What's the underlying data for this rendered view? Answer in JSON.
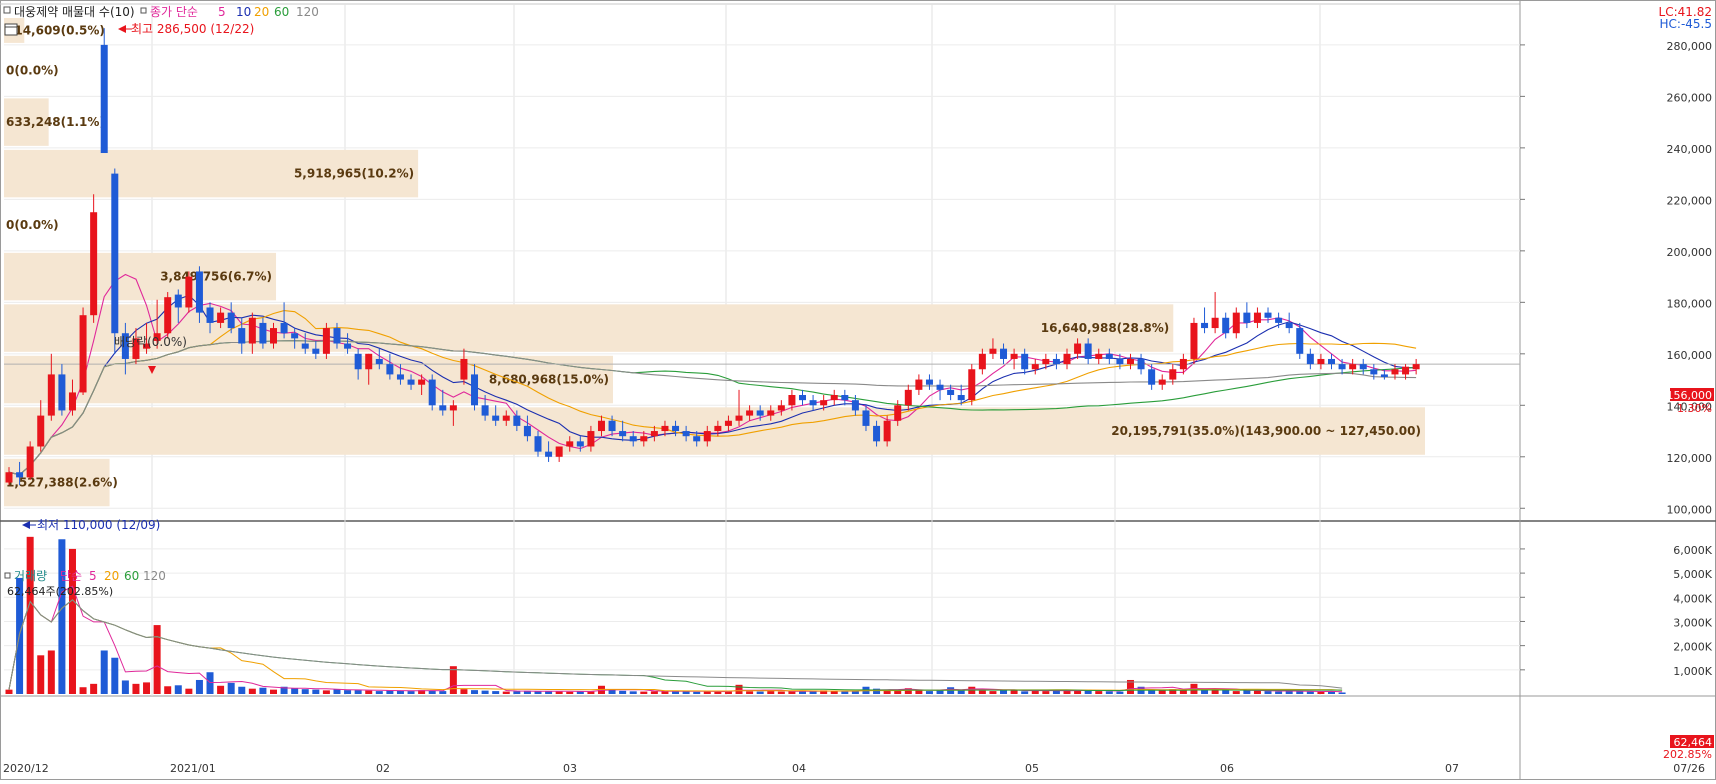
{
  "header": {
    "icon": "square-icon",
    "title": "대웅제약 매물대 수(10)",
    "ma_label": "종가 단순",
    "ma_periods": [
      "5",
      "10",
      "20",
      "60",
      "120"
    ],
    "lc_label": "LC:41.82",
    "hc_label": "HC:-45.5"
  },
  "volume_header": {
    "title": "거래량",
    "ma_label": "단순",
    "ma_periods": [
      "5",
      "20",
      "60",
      "120"
    ],
    "current": "62,464주(202.85%)"
  },
  "annotations": {
    "high": "최고 286,500 (12/22)",
    "low": "최저 110,000 (12/09)",
    "ex_rights": "배당락(0.0%)"
  },
  "badges": {
    "price": "156,000",
    "change": "1.30%",
    "volume": "62,464",
    "volume_pct": "202.85%"
  },
  "colors": {
    "up": "#e8141c",
    "down": "#1f5bd6",
    "ma5": "#e0289a",
    "ma10": "#1b2fb0",
    "ma20": "#f0a000",
    "ma60": "#2a9d3a",
    "ma120": "#8a8a8a",
    "profile": "#f5e6d2",
    "profile_text": "#5a3a10"
  },
  "chart_data": [
    {
      "type": "candlestick",
      "title": "대웅제약 매물대 수(10)",
      "ylim": [
        97000,
        292000
      ],
      "y_ticks": [
        "100,000",
        "120,000",
        "140,000",
        "160,000",
        "180,000",
        "200,000",
        "220,000",
        "240,000",
        "260,000",
        "280,000"
      ],
      "x_labels": [
        "2020/12",
        "2021/01",
        "02",
        "03",
        "04",
        "05",
        "06",
        "07",
        "07/26"
      ],
      "ohlc": [
        [
          110000,
          116000,
          109000,
          114000
        ],
        [
          114000,
          118000,
          109000,
          112000
        ],
        [
          112000,
          126000,
          111000,
          124000
        ],
        [
          124000,
          142000,
          122000,
          136000
        ],
        [
          136000,
          160000,
          134000,
          152000
        ],
        [
          152000,
          156000,
          136000,
          138000
        ],
        [
          138000,
          150000,
          136000,
          145000
        ],
        [
          145000,
          178000,
          144000,
          175000
        ],
        [
          175000,
          222000,
          172000,
          215000
        ],
        [
          280000,
          286500,
          238000,
          238000
        ],
        [
          230000,
          232000,
          160000,
          168000
        ],
        [
          168000,
          172000,
          152000,
          158000
        ],
        [
          158000,
          170000,
          156000,
          166000
        ],
        [
          162000,
          172000,
          160000,
          164000
        ],
        [
          165000,
          181000,
          162000,
          168000
        ],
        [
          168000,
          184000,
          166000,
          182000
        ],
        [
          183000,
          185000,
          172000,
          178000
        ],
        [
          178000,
          192000,
          176000,
          190000
        ],
        [
          192000,
          194000,
          172000,
          176000
        ],
        [
          178000,
          180000,
          168000,
          172000
        ],
        [
          172000,
          178000,
          170000,
          176000
        ],
        [
          176000,
          180000,
          168000,
          170000
        ],
        [
          170000,
          174000,
          160000,
          164000
        ],
        [
          164000,
          176000,
          160000,
          174000
        ],
        [
          172000,
          174000,
          162000,
          164000
        ],
        [
          164000,
          172000,
          162000,
          170000
        ],
        [
          172000,
          180000,
          166000,
          168000
        ],
        [
          168000,
          170000,
          162000,
          166000
        ],
        [
          164000,
          168000,
          160000,
          162000
        ],
        [
          162000,
          165000,
          158000,
          160000
        ],
        [
          160000,
          172000,
          158000,
          170000
        ],
        [
          170000,
          172000,
          162000,
          164000
        ],
        [
          164000,
          168000,
          160000,
          162000
        ],
        [
          160000,
          162000,
          150000,
          154000
        ],
        [
          154000,
          160000,
          148000,
          160000
        ],
        [
          158000,
          162000,
          154000,
          156000
        ],
        [
          156000,
          160000,
          150000,
          152000
        ],
        [
          152000,
          156000,
          148000,
          150000
        ],
        [
          150000,
          152000,
          146000,
          148000
        ],
        [
          148000,
          152000,
          144000,
          150000
        ],
        [
          150000,
          152000,
          138000,
          140000
        ],
        [
          140000,
          146000,
          136000,
          138000
        ],
        [
          138000,
          142000,
          132000,
          140000
        ],
        [
          150000,
          162000,
          148000,
          158000
        ],
        [
          152000,
          156000,
          138000,
          140000
        ],
        [
          140000,
          144000,
          134000,
          136000
        ],
        [
          136000,
          140000,
          132000,
          134000
        ],
        [
          134000,
          138000,
          132000,
          136000
        ],
        [
          136000,
          138000,
          130000,
          132000
        ],
        [
          132000,
          136000,
          126000,
          128000
        ],
        [
          128000,
          130000,
          120000,
          122000
        ],
        [
          122000,
          126000,
          118000,
          120000
        ],
        [
          120000,
          124000,
          118000,
          124000
        ],
        [
          124000,
          128000,
          122000,
          126000
        ],
        [
          126000,
          128000,
          122000,
          124000
        ],
        [
          124000,
          132000,
          122000,
          130000
        ],
        [
          130000,
          136000,
          128000,
          134000
        ],
        [
          134000,
          136000,
          128000,
          130000
        ],
        [
          130000,
          134000,
          126000,
          128000
        ],
        [
          128000,
          130000,
          124000,
          126000
        ],
        [
          126000,
          130000,
          124000,
          128000
        ],
        [
          128000,
          132000,
          126000,
          130000
        ],
        [
          130000,
          134000,
          128000,
          132000
        ],
        [
          132000,
          134000,
          128000,
          130000
        ],
        [
          130000,
          132000,
          126000,
          128000
        ],
        [
          128000,
          130000,
          124000,
          126000
        ],
        [
          126000,
          132000,
          124000,
          130000
        ],
        [
          130000,
          134000,
          128000,
          132000
        ],
        [
          132000,
          136000,
          130000,
          134000
        ],
        [
          134000,
          146000,
          132000,
          136000
        ],
        [
          136000,
          140000,
          134000,
          138000
        ],
        [
          138000,
          140000,
          134000,
          136000
        ],
        [
          136000,
          140000,
          134000,
          138000
        ],
        [
          138000,
          142000,
          136000,
          140000
        ],
        [
          140000,
          146000,
          138000,
          144000
        ],
        [
          144000,
          146000,
          140000,
          142000
        ],
        [
          142000,
          144000,
          138000,
          140000
        ],
        [
          140000,
          144000,
          138000,
          142000
        ],
        [
          142000,
          146000,
          140000,
          144000
        ],
        [
          144000,
          146000,
          140000,
          142000
        ],
        [
          142000,
          144000,
          136000,
          138000
        ],
        [
          138000,
          140000,
          130000,
          132000
        ],
        [
          132000,
          134000,
          124000,
          126000
        ],
        [
          126000,
          136000,
          124000,
          134000
        ],
        [
          134000,
          142000,
          132000,
          140000
        ],
        [
          140000,
          148000,
          138000,
          146000
        ],
        [
          146000,
          152000,
          144000,
          150000
        ],
        [
          150000,
          152000,
          146000,
          148000
        ],
        [
          148000,
          150000,
          142000,
          146000
        ],
        [
          146000,
          148000,
          142000,
          144000
        ],
        [
          144000,
          148000,
          140000,
          142000
        ],
        [
          142000,
          156000,
          140000,
          154000
        ],
        [
          154000,
          162000,
          152000,
          160000
        ],
        [
          160000,
          166000,
          158000,
          162000
        ],
        [
          162000,
          164000,
          156000,
          158000
        ],
        [
          158000,
          162000,
          154000,
          160000
        ],
        [
          160000,
          162000,
          152000,
          154000
        ],
        [
          154000,
          158000,
          152000,
          156000
        ],
        [
          156000,
          160000,
          154000,
          158000
        ],
        [
          158000,
          160000,
          154000,
          156000
        ],
        [
          156000,
          162000,
          154000,
          160000
        ],
        [
          160000,
          166000,
          158000,
          164000
        ],
        [
          164000,
          166000,
          156000,
          158000
        ],
        [
          158000,
          162000,
          156000,
          160000
        ],
        [
          160000,
          162000,
          156000,
          158000
        ],
        [
          158000,
          160000,
          154000,
          156000
        ],
        [
          156000,
          160000,
          154000,
          158000
        ],
        [
          158000,
          160000,
          152000,
          154000
        ],
        [
          154000,
          156000,
          146000,
          148000
        ],
        [
          148000,
          152000,
          146000,
          150000
        ],
        [
          150000,
          156000,
          148000,
          154000
        ],
        [
          154000,
          160000,
          152000,
          158000
        ],
        [
          158000,
          174000,
          156000,
          172000
        ],
        [
          172000,
          178000,
          168000,
          170000
        ],
        [
          170000,
          184000,
          168000,
          174000
        ],
        [
          174000,
          176000,
          166000,
          168000
        ],
        [
          168000,
          178000,
          166000,
          176000
        ],
        [
          176000,
          180000,
          170000,
          172000
        ],
        [
          172000,
          178000,
          170000,
          176000
        ],
        [
          176000,
          178000,
          172000,
          174000
        ],
        [
          174000,
          176000,
          170000,
          172000
        ],
        [
          172000,
          176000,
          168000,
          170000
        ],
        [
          170000,
          172000,
          158000,
          160000
        ],
        [
          160000,
          162000,
          154000,
          156000
        ],
        [
          156000,
          160000,
          154000,
          158000
        ],
        [
          158000,
          160000,
          154000,
          156000
        ],
        [
          156000,
          158000,
          152000,
          154000
        ],
        [
          154000,
          158000,
          152000,
          156000
        ],
        [
          156000,
          158000,
          152000,
          154000
        ],
        [
          154000,
          156000,
          150000,
          152000
        ],
        [
          152000,
          154000,
          150000,
          151000
        ],
        [
          152000,
          156000,
          150000,
          154000
        ],
        [
          152000,
          156000,
          150000,
          155000
        ],
        [
          154000,
          158000,
          152000,
          156000
        ]
      ],
      "ma_lines": [
        "MA5",
        "MA10",
        "MA20",
        "MA60",
        "MA120"
      ],
      "volume_profile": [
        {
          "low": 100000,
          "high": 120000,
          "label": "1,527,388(2.6%)",
          "pct": 2.6
        },
        {
          "low": 120000,
          "high": 140000,
          "label": "20,195,791(35.0%)(143,900.00 ~ 127,450.00)",
          "pct": 35.0
        },
        {
          "low": 140000,
          "high": 160000,
          "label": "8,680,968(15.0%)",
          "pct": 15.0
        },
        {
          "low": 160000,
          "high": 180000,
          "label": "16,640,988(28.8%)",
          "pct": 28.8
        },
        {
          "low": 180000,
          "high": 200000,
          "label": "3,849,756(6.7%)",
          "pct": 6.7
        },
        {
          "low": 200000,
          "high": 220000,
          "label": "0(0.0%)",
          "pct": 0.0
        },
        {
          "low": 220000,
          "high": 240000,
          "label": "5,918,965(10.2%)",
          "pct": 10.2
        },
        {
          "low": 240000,
          "high": 260000,
          "label": "633,248(1.1%)",
          "pct": 1.1
        },
        {
          "low": 260000,
          "high": 280000,
          "label": "0(0.0%)",
          "pct": 0.0
        },
        {
          "low": 280000,
          "high": 300000,
          "label": "314,609(0.5%)",
          "pct": 0.5
        }
      ]
    },
    {
      "type": "bar",
      "title": "거래량",
      "ylim": [
        0,
        6700
      ],
      "y_ticks": [
        "1,000K",
        "2,000K",
        "3,000K",
        "4,000K",
        "5,000K",
        "6,000K"
      ],
      "values_k": [
        180,
        4800,
        6500,
        1600,
        1800,
        6400,
        6000,
        280,
        420,
        1800,
        1500,
        560,
        420,
        480,
        2850,
        320,
        360,
        220,
        580,
        900,
        340,
        460,
        300,
        220,
        260,
        180,
        300,
        240,
        200,
        180,
        150,
        200,
        160,
        160,
        140,
        120,
        150,
        140,
        120,
        160,
        140,
        120,
        1150,
        200,
        160,
        140,
        120,
        100,
        110,
        130,
        120,
        120,
        100,
        90,
        110,
        100,
        340,
        200,
        130,
        110,
        100,
        110,
        120,
        130,
        110,
        90,
        100,
        90,
        100,
        380,
        110,
        100,
        120,
        100,
        110,
        130,
        120,
        150,
        110,
        100,
        120,
        300,
        220,
        140,
        130,
        240,
        150,
        120,
        180,
        280,
        160,
        300,
        140,
        120,
        150,
        180,
        110,
        140,
        120,
        160,
        150,
        130,
        180,
        120,
        110,
        100,
        580,
        300,
        180,
        150,
        200,
        180,
        420,
        160,
        180,
        160,
        120,
        150,
        140,
        120,
        100,
        120,
        110,
        100,
        90,
        110,
        62
      ]
    }
  ]
}
